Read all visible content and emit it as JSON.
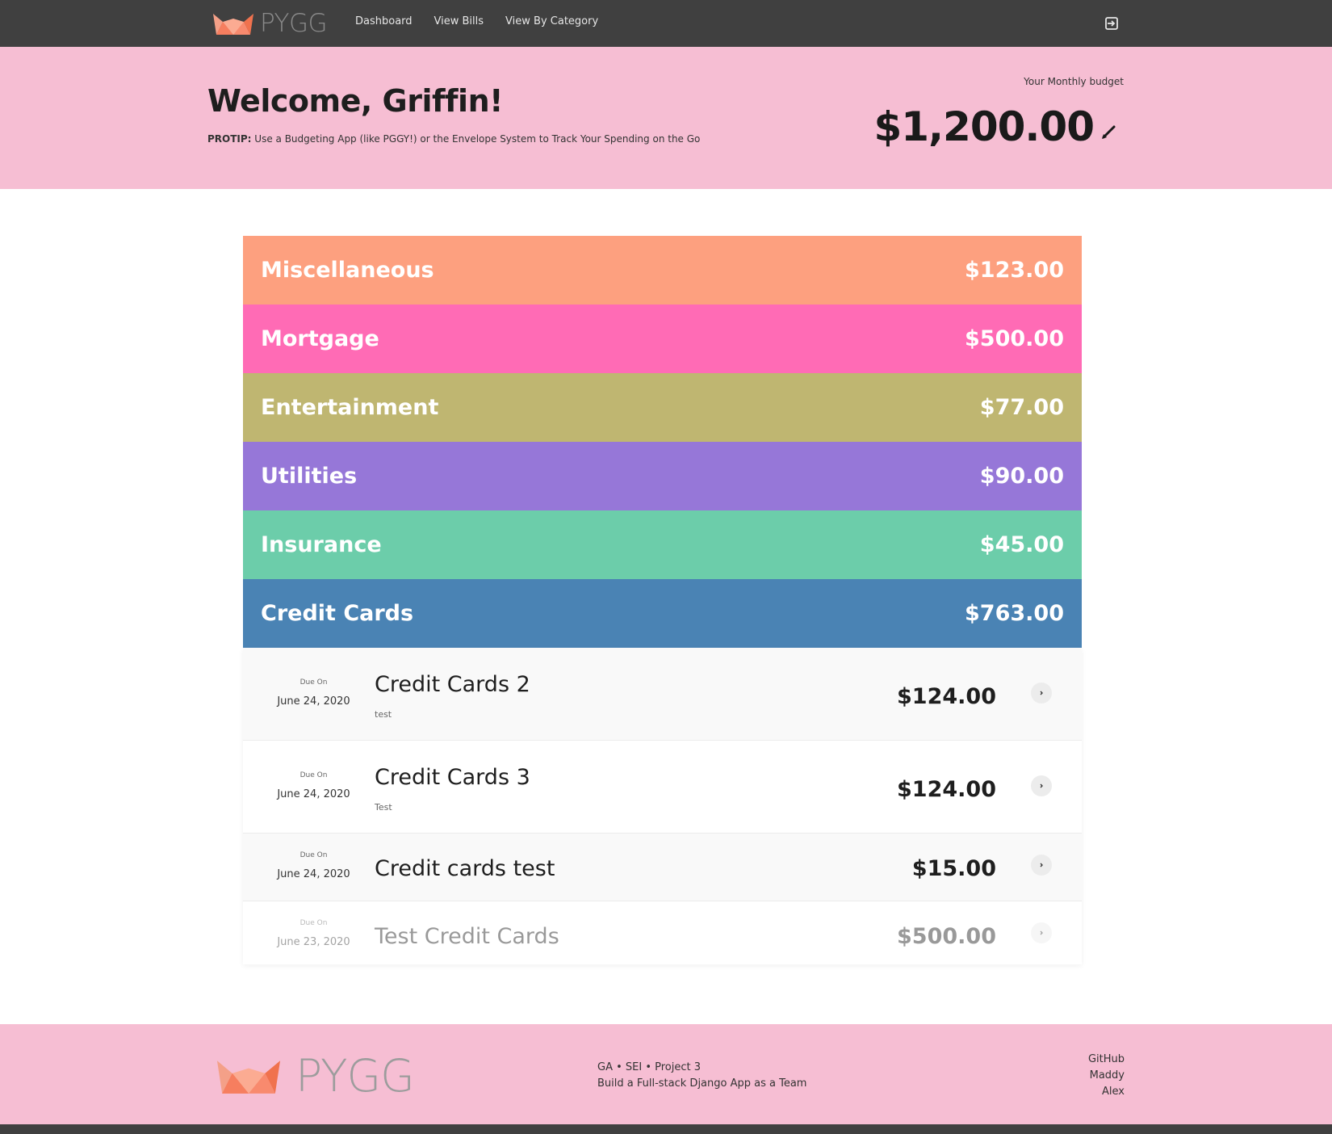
{
  "brand": {
    "name": "PYGG",
    "logo_icon": "pig-icon",
    "accent": "#f88a6e"
  },
  "nav": {
    "items": [
      "Dashboard",
      "View Bills",
      "View By Category"
    ],
    "logout_icon": "logout-icon"
  },
  "hero": {
    "welcome": "Welcome, Griffin!",
    "protip_label": "PROTIP:",
    "protip_text": " Use a Budgeting App (like PGGY!) or the Envelope System to Track Your Spending on the Go",
    "budget_label": "Your Monthly budget",
    "budget_value": "$1,200.00",
    "edit_icon": "pencil-icon",
    "background": "#f6bed3"
  },
  "categories": [
    {
      "name": "Miscellaneous",
      "amount": "$123.00",
      "color": "#fda07f"
    },
    {
      "name": "Mortgage",
      "amount": "$500.00",
      "color": "#ff6bb5"
    },
    {
      "name": "Entertainment",
      "amount": "$77.00",
      "color": "#bfb671"
    },
    {
      "name": "Utilities",
      "amount": "$90.00",
      "color": "#9677d8"
    },
    {
      "name": "Insurance",
      "amount": "$45.00",
      "color": "#6ccdaa"
    },
    {
      "name": "Credit Cards",
      "amount": "$763.00",
      "color": "#4a83b4"
    }
  ],
  "bills": [
    {
      "due_label": "Due On",
      "due_date": "June 24, 2020",
      "title": "Credit Cards 2",
      "note": "test",
      "amount": "$124.00"
    },
    {
      "due_label": "Due On",
      "due_date": "June 24, 2020",
      "title": "Credit Cards 3",
      "note": "Test",
      "amount": "$124.00"
    },
    {
      "due_label": "Due On",
      "due_date": "June 24, 2020",
      "title": "Credit cards test",
      "note": "",
      "amount": "$15.00"
    },
    {
      "due_label": "Due On",
      "due_date": "June 23, 2020",
      "title": "Test Credit Cards",
      "note": "",
      "amount": "$500.00"
    }
  ],
  "footer": {
    "brand": "PYGG",
    "line1": "GA • SEI • Project 3",
    "line2": "Build a Full-stack Django App as a Team",
    "links": [
      "GitHub",
      "Maddy",
      "Alex"
    ]
  }
}
